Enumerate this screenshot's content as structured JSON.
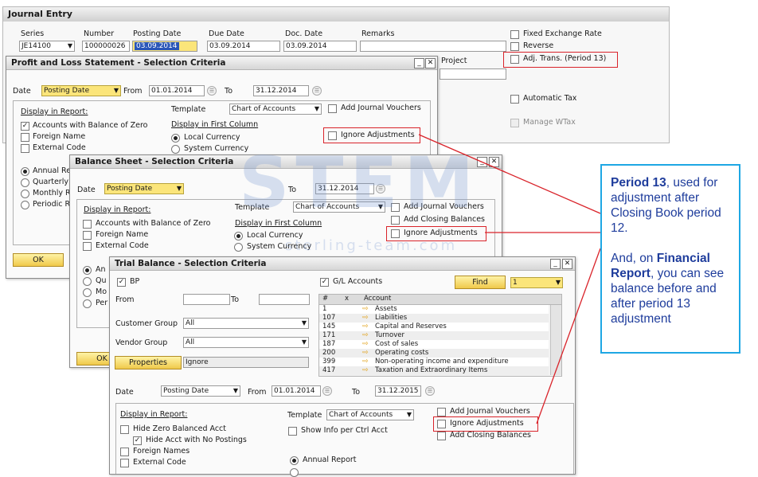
{
  "journal": {
    "title": "Journal Entry",
    "series_label": "Series",
    "series_value": "JE14100",
    "number_label": "Number",
    "number_value": "100000026",
    "posting_date_label": "Posting Date",
    "posting_date_value": "03.09.2014",
    "due_date_label": "Due Date",
    "due_date_value": "03.09.2014",
    "doc_date_label": "Doc. Date",
    "doc_date_value": "03.09.2014",
    "remarks_label": "Remarks",
    "project_label": "Project",
    "fixed_exchange_rate": "Fixed Exchange Rate",
    "reverse": "Reverse",
    "adj_trans": "Adj. Trans. (Period 13)",
    "automatic_tax": "Automatic Tax",
    "manage_wtax": "Manage WTax"
  },
  "pnl": {
    "title": "Profit and Loss Statement - Selection Criteria",
    "date_label": "Date",
    "date_type": "Posting Date",
    "from_label": "From",
    "from_value": "01.01.2014",
    "to_label": "To",
    "to_value": "31.12.2014",
    "display_in_report": "Display in Report:",
    "template_label": "Template",
    "template_value": "Chart of Accounts",
    "add_journal_vouchers": "Add Journal Vouchers",
    "ignore_adjustments": "Ignore Adjustments",
    "accounts_with_balance": "Accounts with Balance of Zero",
    "foreign_name": "Foreign Name",
    "external_code": "External Code",
    "display_first_column": "Display in First Column",
    "local_currency": "Local Currency",
    "system_currency": "System Currency",
    "annual": "Annual Re",
    "quarterly": "Quarterly I",
    "monthly": "Monthly R",
    "periodic": "Periodic R",
    "ok": "OK"
  },
  "bs": {
    "title": "Balance Sheet - Selection Criteria",
    "date_label": "Date",
    "date_type": "Posting Date",
    "to_label": "To",
    "to_value": "31.12.2014",
    "display_in_report": "Display in Report:",
    "template_label": "Template",
    "template_value": "Chart of Accounts",
    "add_journal_vouchers": "Add Journal Vouchers",
    "add_closing_balances": "Add Closing Balances",
    "ignore_adjustments": "Ignore Adjustments",
    "accounts_with_balance": "Accounts with Balance of Zero",
    "foreign_name": "Foreign Name",
    "external_code": "External Code",
    "display_first_column": "Display in First Column",
    "local_currency": "Local Currency",
    "system_currency": "System Currency",
    "r1": "An",
    "r2": "Qu",
    "r3": "Mo",
    "r4": "Per",
    "ok": "OK"
  },
  "tb": {
    "title": "Trial Balance - Selection Criteria",
    "bp_label": "BP",
    "gl_accounts_label": "G/L Accounts",
    "find": "Find",
    "level_value": "1",
    "from_label": "From",
    "to_label": "To",
    "customer_group_label": "Customer Group",
    "customer_group_value": "All",
    "vendor_group_label": "Vendor Group",
    "vendor_group_value": "All",
    "properties": "Properties",
    "properties_value": "Ignore",
    "col_hash": "#",
    "col_x": "x",
    "col_account": "Account",
    "accounts": [
      {
        "num": "1",
        "name": "Assets"
      },
      {
        "num": "107",
        "name": "Liabilities"
      },
      {
        "num": "145",
        "name": "Capital and Reserves"
      },
      {
        "num": "171",
        "name": "Turnover"
      },
      {
        "num": "187",
        "name": "Cost of sales"
      },
      {
        "num": "200",
        "name": "Operating costs"
      },
      {
        "num": "399",
        "name": "Non-operating income and expenditure"
      },
      {
        "num": "417",
        "name": "Taxation and Extraordinary Items"
      }
    ],
    "date_label": "Date",
    "date_type": "Posting Date",
    "from_value": "01.01.2014",
    "to_value": "31.12.2015",
    "display_in_report": "Display in Report:",
    "template_label": "Template",
    "template_value": "Chart of Accounts",
    "add_journal_vouchers": "Add Journal Vouchers",
    "ignore_adjustments": "Ignore Adjustments",
    "add_closing_balances": "Add Closing Balances",
    "hide_zero_balanced": "Hide Zero Balanced Acct",
    "hide_no_postings": "Hide Acct with No Postings",
    "foreign_names": "Foreign Names",
    "external_code": "External Code",
    "show_info_per_ctrl": "Show Info per Ctrl Acct",
    "annual_report": "Annual Report"
  },
  "watermark": {
    "logo": "STEM",
    "site": "sterling-team.com"
  },
  "callout": {
    "p1_bold": "Period 13",
    "p1_rest": ", used for adjustment after Closing Book period 12.",
    "p2_start": "And, on ",
    "p2_bold": "Financial Report",
    "p2_rest": ", you can see balance before and after period 13 adjustment"
  },
  "colors": {
    "accent_red": "#d9232a",
    "callout_border": "#1ea7e4",
    "callout_text": "#1f3d9c",
    "field_yellow": "#fbe57a"
  }
}
